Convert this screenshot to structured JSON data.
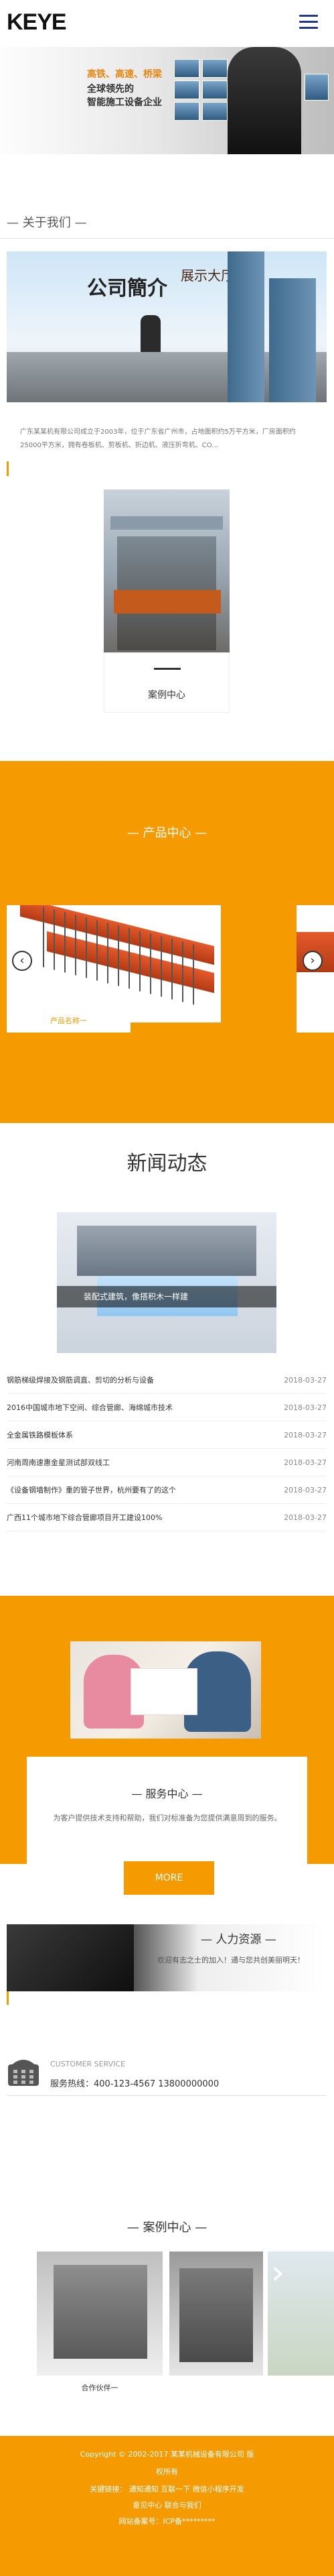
{
  "header": {
    "logo": "KEYE"
  },
  "banner": {
    "slogan_highlight": "高铁、高速、桥梁",
    "slogan_line2": "全球领先的",
    "slogan_line3": "智能施工设备企业"
  },
  "about": {
    "title": "— 关于我们 —",
    "building_sign": "公司簡介",
    "building_sign2": "展示大厅",
    "text": "广东某某机有限公司成立于2003年，位于广东省广州市，占地面积约5万平方米，厂房面积约25000平方米，拥有卷板机、剪板机、折边机、液压折弯机、CO..."
  },
  "case_thumb": {
    "label": "案例中心"
  },
  "products": {
    "title": "— 产品中心 —",
    "card_label": "产品名称一",
    "prev_icon": "chevron-left-icon",
    "next_icon": "chevron-right-icon"
  },
  "news": {
    "title": "新闻动态",
    "image_caption": "装配式建筑，像搭积木一样建",
    "items": [
      {
        "title": "钢筋梯级焊接及钢筋调直、剪切的分析与设备",
        "date": "2018-03-27"
      },
      {
        "title": "2016中国城市地下空间、综合管廊、海绵城市技术",
        "date": "2018-03-27"
      },
      {
        "title": "全金属铁路模板体系",
        "date": "2018-03-27"
      },
      {
        "title": "河南周南速惠金星测试部双线工",
        "date": "2018-03-27"
      },
      {
        "title": "《设备钢墙制作》重的管子世界，杭州要有了的这个",
        "date": "2018-03-27"
      },
      {
        "title": "广西11个城市地下综合管廊项目开工建设100%",
        "date": "2018-03-27"
      }
    ]
  },
  "service": {
    "title": "— 服务中心 —",
    "desc": "为客户提供技术支持和帮助，我们对标准备为您提供满意周到的服务。",
    "more": "MORE"
  },
  "hr": {
    "title": "— 人力资源 —",
    "desc": "欢迎有志之士的加入！通与您共创美丽明天！"
  },
  "customer_service": {
    "label": "CUSTOMER SERVICE",
    "hotline": "服务热线：400-123-4567 13800000000",
    "icon": "telephone-icon"
  },
  "cases": {
    "title": "— 案例中心 —",
    "caption": "合作伙伴一"
  },
  "footer": {
    "copyright": "Copyright © 2002-2017 某某机械设备有限公司 版",
    "rights": "权所有",
    "links": "关键链接：  通知通知  互联一下  微信小程序开发",
    "nav": "意见中心  联合与我们",
    "icp": "网站备案号：ICP备*********"
  },
  "colors": {
    "accent": "#f59a00",
    "menu_bar": "#1f3a8a"
  }
}
